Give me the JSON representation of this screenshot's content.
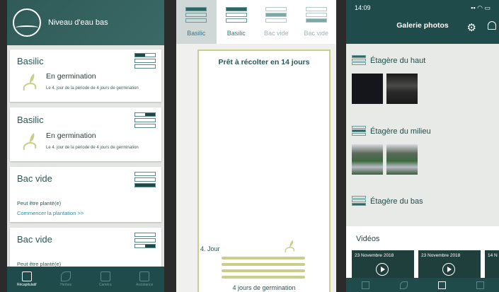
{
  "panel1": {
    "header": {
      "title": "Niveau d'eau bas"
    },
    "cards": [
      {
        "title": "Basilic",
        "status": "En germination",
        "detail": "Le 4. jour de la période de 4 jours de germination"
      },
      {
        "title": "Basilic",
        "status": "En germination",
        "detail": "Le 4. jour de la période de 4 jours de germination"
      },
      {
        "title": "Bac vide",
        "sub1": "Peut être planté(e)",
        "sub2": "Commencer la plantation >>"
      },
      {
        "title": "Bac vide",
        "sub1": "Peut être planté(e)"
      }
    ],
    "nav": [
      {
        "label": "Récapitulatif",
        "icon": "summary-icon",
        "active": true
      },
      {
        "label": "Herbes",
        "icon": "leaf-icon",
        "active": false
      },
      {
        "label": "Caméra",
        "icon": "camera-icon",
        "active": false
      },
      {
        "label": "Assistance",
        "icon": "document-icon",
        "active": false
      }
    ]
  },
  "panel2": {
    "tabs": [
      {
        "label": "Basilic",
        "selected": true
      },
      {
        "label": "Basilic",
        "selected": false
      },
      {
        "label": "Bac vide",
        "selected": false
      },
      {
        "label": "Bac vide",
        "selected": false
      }
    ],
    "heading": "Prêt à récolter en 14 jours",
    "day": "4. Jour",
    "footer": "4 jours de germination"
  },
  "panel3": {
    "status_time": "14:09",
    "title": "Galerie photos",
    "sections": [
      "Étagère du haut",
      "Étagère du milieu",
      "Étagère du bas"
    ],
    "videos_heading": "Vidéos",
    "videos": [
      "23 Novembre 2018",
      "23 Novembre 2018",
      "14 N"
    ],
    "colors": {
      "primary": "#1f4c4a",
      "accent": "#c9cf8a",
      "link": "#2e8aa0"
    }
  }
}
